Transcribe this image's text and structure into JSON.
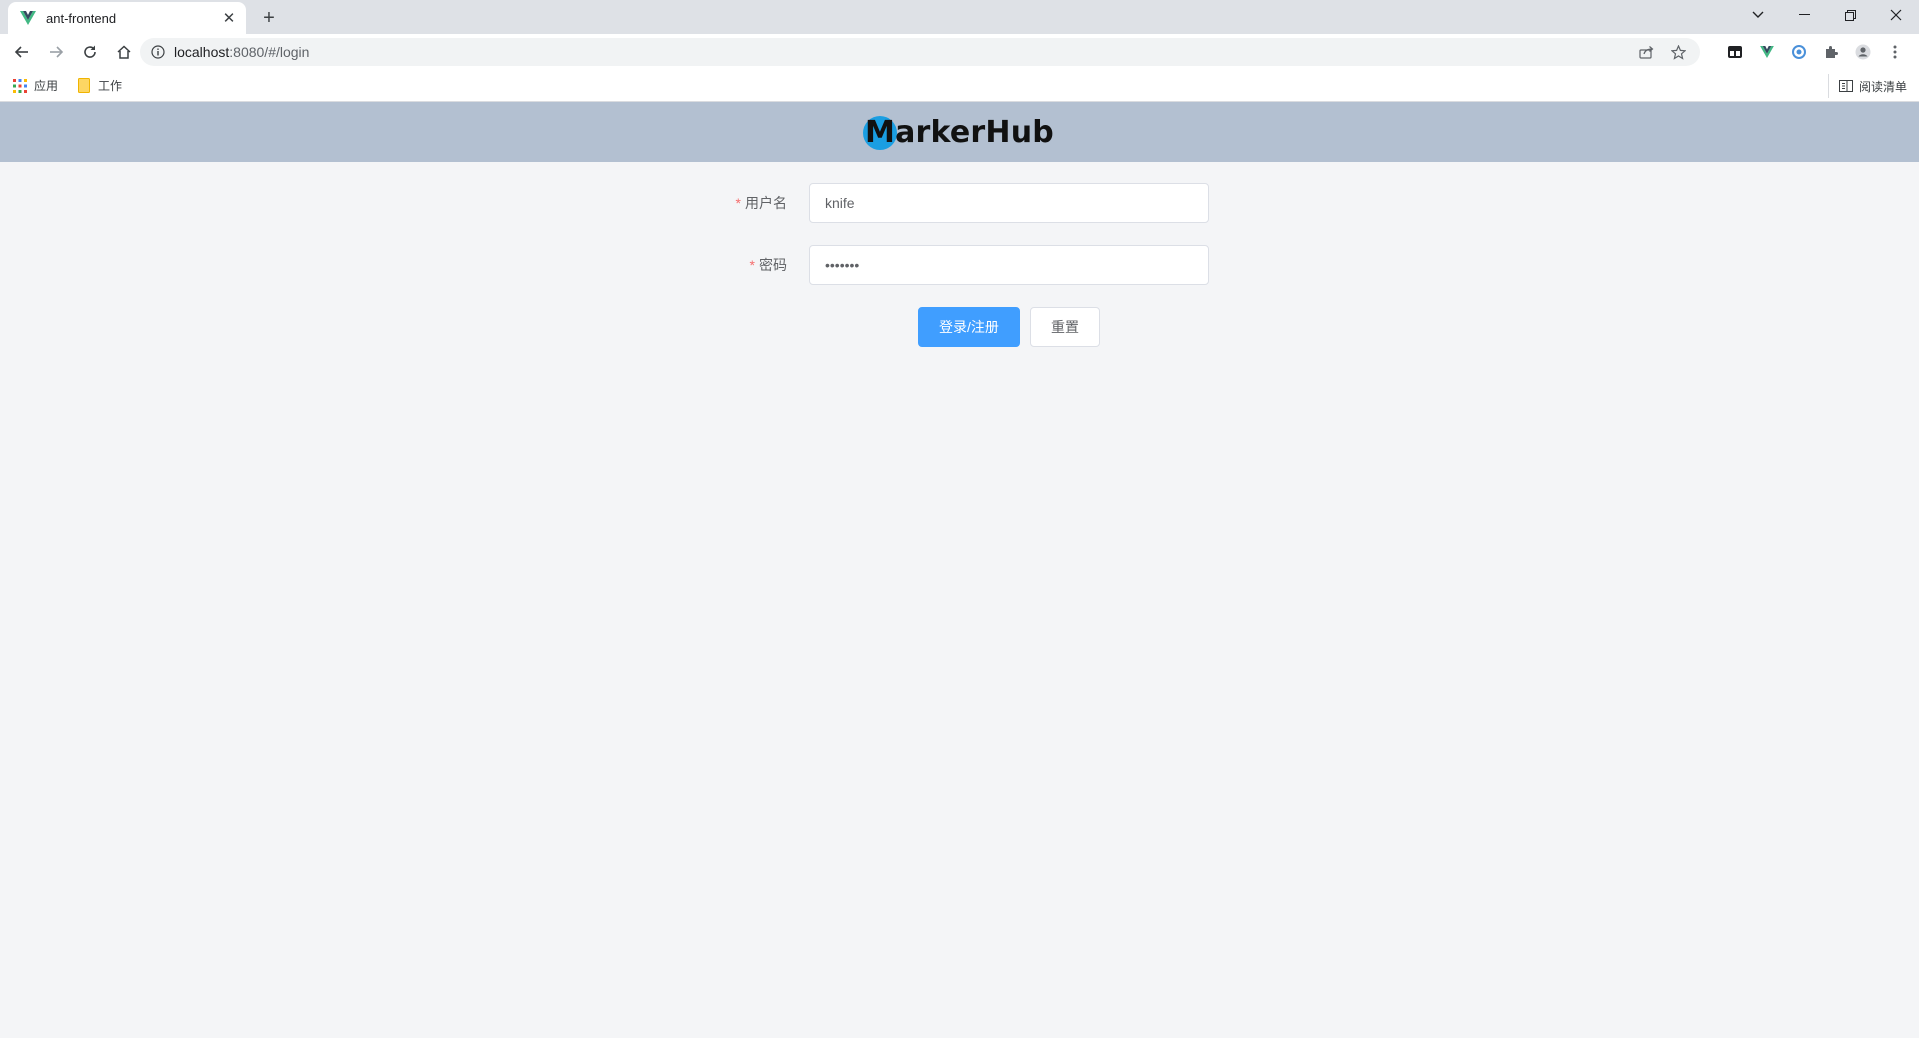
{
  "browser": {
    "tab_title": "ant-frontend",
    "url_host": "localhost",
    "url_rest": ":8080/#/login",
    "bookmarks": [
      {
        "label": "应用",
        "icon": "apps-grid-icon"
      },
      {
        "label": "工作",
        "icon": "folder-icon"
      }
    ],
    "reading_list_label": "阅读清单"
  },
  "header": {
    "logo_text": "MarkerHub",
    "logo_accent_color": "#1a9ee2",
    "background_color": "#b3c0d1"
  },
  "login_form": {
    "username_label": "用户名",
    "username_value": "knife",
    "password_label": "密码",
    "password_value": "•••••••",
    "required_mark": "*",
    "submit_label": "登录/注册",
    "reset_label": "重置",
    "primary_color": "#409eff"
  }
}
